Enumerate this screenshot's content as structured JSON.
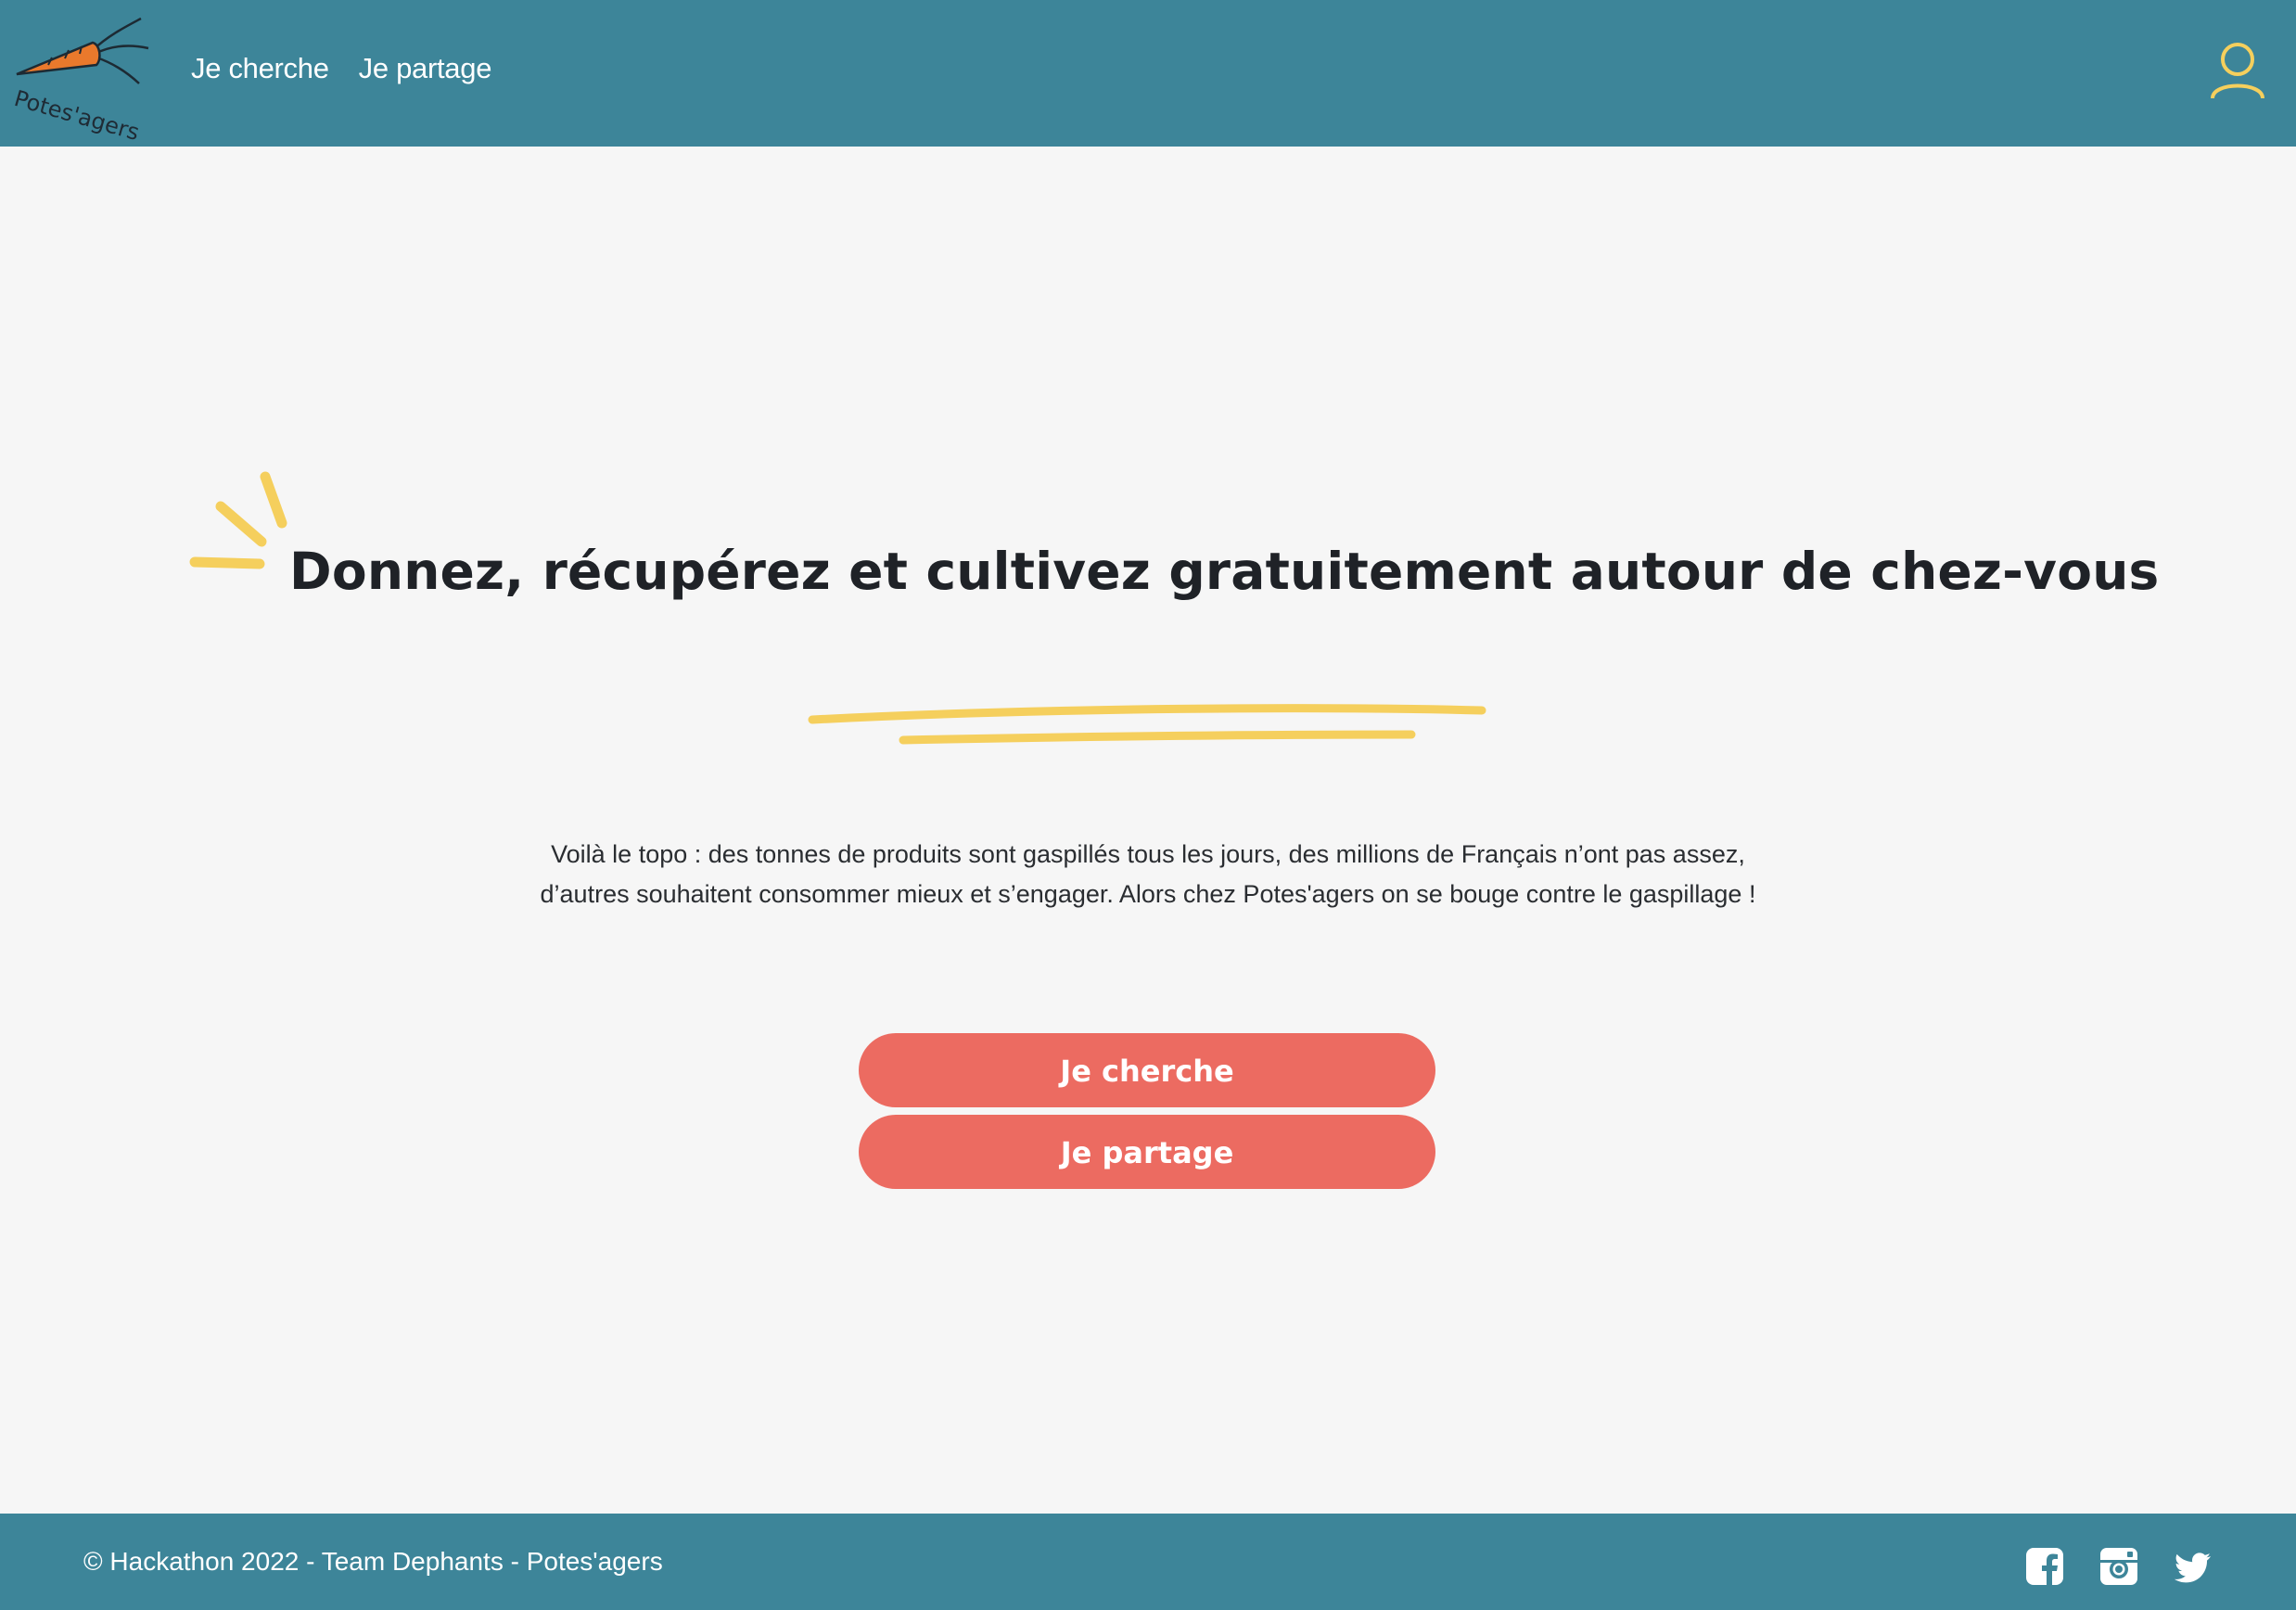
{
  "colors": {
    "header_bg": "#3d8599",
    "accent_yellow": "#f5cf5d",
    "button_bg": "#ec6b61",
    "carrot": "#e9792c",
    "background": "#f6f6f6"
  },
  "header": {
    "logo_text": "Potes'agers",
    "nav": [
      {
        "label": "Je cherche"
      },
      {
        "label": "Je partage"
      }
    ],
    "user_icon": "user-icon"
  },
  "hero": {
    "title": "Donnez, récupérez et cultivez gratuitement autour de chez-vous",
    "intro_line1": "Voilà le topo : des tonnes de produits sont gaspillés tous les jours, des millions de Français n’ont pas assez,",
    "intro_line2": "d’autres souhaitent consommer mieux et s’engager. Alors chez Potes'agers on se bouge contre le gaspillage !"
  },
  "actions": {
    "search_label": "Je cherche",
    "share_label": "Je partage"
  },
  "footer": {
    "copyright": "© Hackathon 2022 - Team Dephants - Potes'agers",
    "socials": [
      "facebook-icon",
      "instagram-icon",
      "twitter-icon"
    ]
  }
}
